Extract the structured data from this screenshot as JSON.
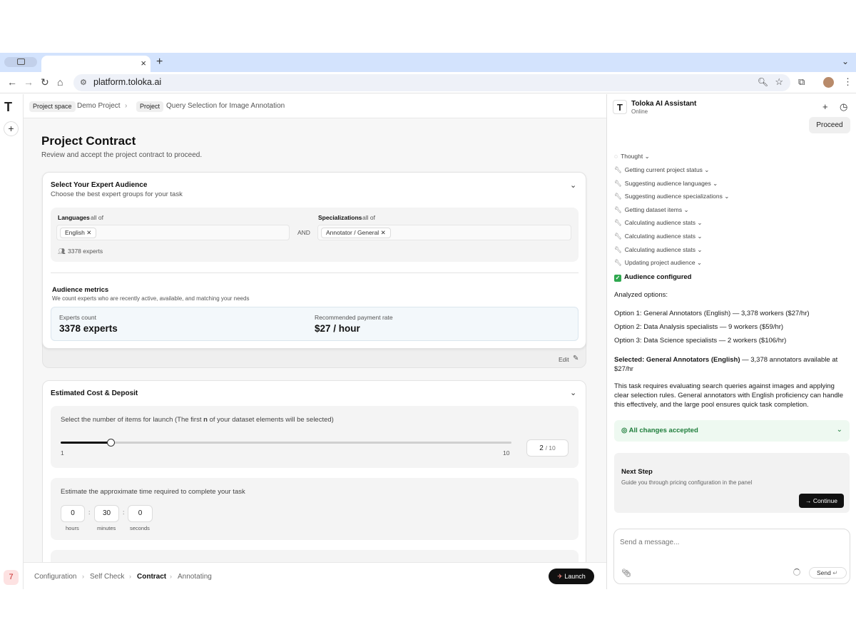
{
  "browser": {
    "url": "platform.toloka.ai",
    "new_tab": "+",
    "close_tab": "×"
  },
  "app": {
    "rail_logo": "T",
    "rail_add": "+",
    "notification_count": "7"
  },
  "breadcrumb": {
    "project_space_tag": "Project space",
    "project_space_name": "Demo Project",
    "project_tag": "Project",
    "project_name": "Query Selection for Image Annotation"
  },
  "page": {
    "title": "Project Contract",
    "subtitle": "Review and accept the project contract to proceed."
  },
  "audience": {
    "title": "Select Your Expert Audience",
    "subtitle": "Choose the best expert groups for your task",
    "languages_label": "Languages",
    "languages_mode": "all of",
    "language_chip": "English",
    "and_label": "AND",
    "specializations_label": "Specializations",
    "specializations_mode": "all of",
    "specialization_chip": "Annotator / General",
    "experts_note": "3378 experts",
    "metrics_title": "Audience metrics",
    "metrics_subtitle": "We count experts who are recently active, available, and matching your needs",
    "experts_count_label": "Experts count",
    "experts_count_value": "3378 experts",
    "payment_label": "Recommended payment rate",
    "payment_value": "$27 / hour",
    "edit_label": "Edit"
  },
  "cost": {
    "title": "Estimated Cost & Deposit",
    "items_prompt_pre": "Select the number of items for launch (The first ",
    "items_prompt_n": "n",
    "items_prompt_post": " of your dataset elements will be selected)",
    "slider_min": "1",
    "slider_max": "10",
    "slider_value": 2,
    "slider_range": [
      1,
      10
    ],
    "items_value": "2",
    "items_total": "/ 10",
    "time_prompt": "Estimate the approximate time required to complete your task",
    "hours_value": "0",
    "minutes_value": "30",
    "seconds_value": "0",
    "hours_label": "hours",
    "minutes_label": "minutes",
    "seconds_label": "seconds"
  },
  "steps": {
    "items": [
      "Configuration",
      "Self Check",
      "Contract",
      "Annotating"
    ],
    "active": "Contract",
    "launch_label": "Launch"
  },
  "assistant": {
    "title": "Toloka AI Assistant",
    "status": "Online",
    "proceed_bubble": "Proceed",
    "thought": "Thought",
    "tools": [
      "Getting current project status",
      "Suggesting audience languages",
      "Suggesting audience specializations",
      "Getting dataset items",
      "Calculating audience stats",
      "Calculating audience stats",
      "Calculating audience stats",
      "Updating project audience"
    ],
    "configured": "Audience configured",
    "analyzed": "Analyzed options:",
    "option1": "Option 1: General Annotators (English) — 3,378 workers ($27/hr)",
    "option2": "Option 2: Data Analysis specialists — 9 workers ($59/hr)",
    "option3": "Option 3: Data Science specialists — 2 workers ($106/hr)",
    "selected_bold": "Selected: General Annotators (English)",
    "selected_rest": " — 3,378 annotators available at $27/hr",
    "explanation": "This task requires evaluating search queries against images and applying clear selection rules. General annotators with English proficiency can handle this effectively, and the large pool ensures quick task completion.",
    "accepted": "All changes accepted",
    "next_step_title": "Next Step",
    "next_step_desc": "Guide you through pricing configuration in the panel",
    "continue_label": "Continue",
    "composer_placeholder": "Send a message...",
    "send_label": "Send"
  },
  "colors": {
    "accent_green": "#2fa84f",
    "primary_dark": "#111111",
    "tab_bar": "#d3e3fd"
  }
}
